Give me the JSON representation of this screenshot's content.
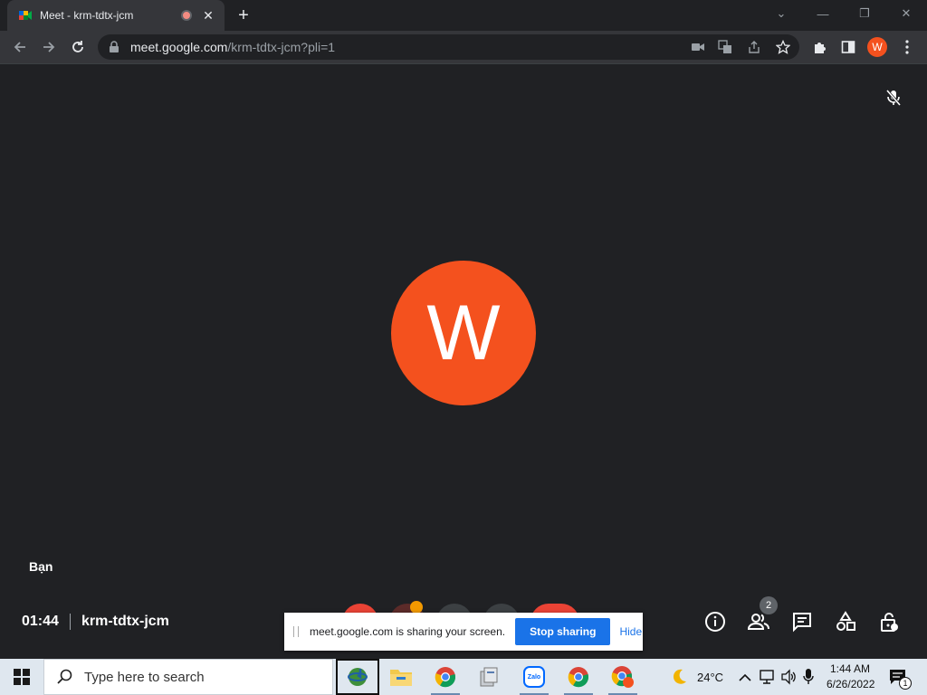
{
  "browser": {
    "tab_title": "Meet - krm-tdtx-jcm",
    "tab_close": "✕",
    "new_tab": "+",
    "url_host": "meet.google.com",
    "url_path": "/krm-tdtx-jcm?pli=1",
    "profile_initial": "W",
    "window_controls": {
      "dropdown": "⌄",
      "minimize": "—",
      "restore": "❐",
      "close": "✕"
    }
  },
  "meet": {
    "avatar_initial": "W",
    "self_name": "Bạn",
    "time": "01:44",
    "meeting_code": "krm-tdtx-jcm",
    "participants_count": "2",
    "colors": {
      "accent": "#f4511e",
      "background": "#202124",
      "end_call": "#ea4335"
    }
  },
  "share_bar": {
    "message": "meet.google.com is sharing your screen.",
    "stop_label": "Stop sharing",
    "hide_label": "Hide"
  },
  "taskbar": {
    "search_placeholder": "Type here to search",
    "apps": [
      "internet-download-manager-icon",
      "file-explorer-icon",
      "chrome-icon",
      "app-icon",
      "zalo-icon",
      "chrome-icon",
      "chrome-profile-icon"
    ],
    "zalo_label": "Zalo",
    "temperature": "24°C",
    "time": "1:44 AM",
    "date": "6/26/2022",
    "notification_count": "1"
  }
}
